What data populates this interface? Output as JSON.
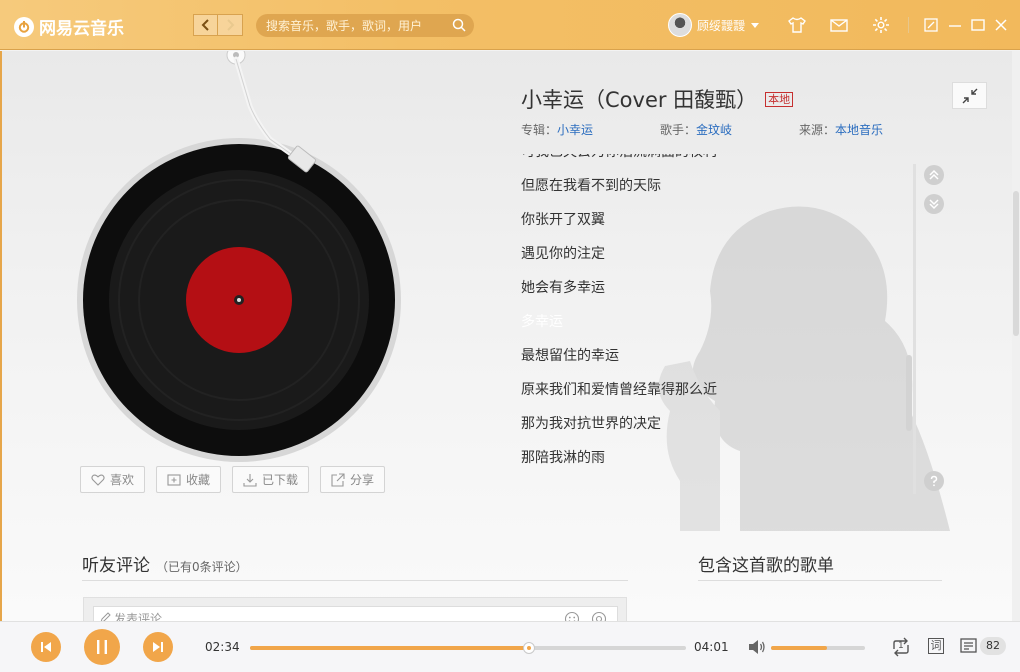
{
  "app": {
    "logo_text": "网易云音乐",
    "accent_color": "#f1a64a"
  },
  "titlebar": {
    "back_icon": "chevron-left-icon",
    "forward_icon": "chevron-right-icon",
    "search_placeholder": "搜索音乐，歌手，歌词，用户",
    "username": "顾绥靉靉",
    "icons": [
      "skin-icon",
      "mail-icon",
      "settings-icon",
      "mini-mode-icon",
      "minimize-icon",
      "maximize-icon",
      "close-icon"
    ]
  },
  "song": {
    "title": "小幸运（Cover 田馥甄）",
    "tag": "本地",
    "album_label": "专辑：",
    "album": "小幸运",
    "artist_label": "歌手：",
    "artist": "金玟岐",
    "source_label": "来源：",
    "source": "本地音乐"
  },
  "actions": {
    "like": "喜欢",
    "collect": "收藏",
    "downloaded": "已下载",
    "share": "分享"
  },
  "lyrics": {
    "lines": [
      "可我已失去为你泪流满面的权利",
      "但愿在我看不到的天际",
      "你张开了双翼",
      "遇见你的注定",
      "她会有多幸运",
      "多幸运",
      "最想留住的幸运",
      "原来我们和爱情曾经靠得那么近",
      "那为我对抗世界的决定",
      "那陪我淋的雨"
    ],
    "current_index": 5
  },
  "comments": {
    "title": "听友评论",
    "count_text": "（已有0条评论）",
    "input_placeholder": "发表评论"
  },
  "playlists": {
    "title": "包含这首歌的歌单"
  },
  "player": {
    "current_time": "02:34",
    "total_time": "04:01",
    "progress": 0.6388,
    "volume": 0.6,
    "loop_badge": "1",
    "lyric_button": "词",
    "playlist_count": "82"
  }
}
